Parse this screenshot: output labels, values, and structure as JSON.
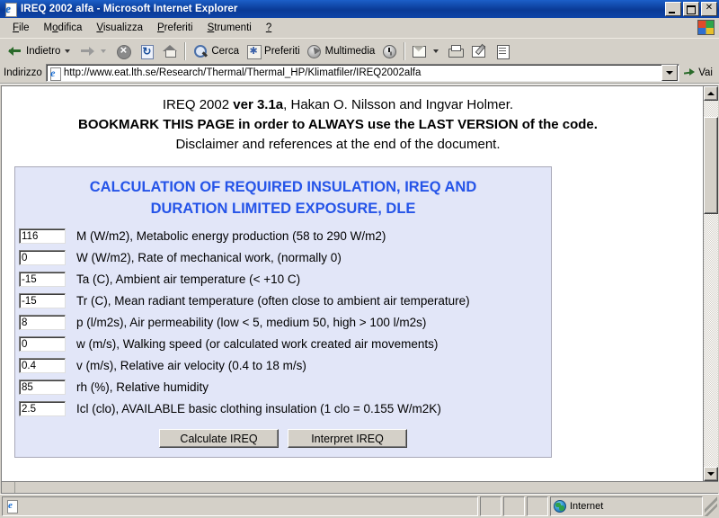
{
  "window": {
    "title": "IREQ 2002 alfa - Microsoft Internet Explorer",
    "icon": "ie-page-icon",
    "minimize_label": "_",
    "maximize_label": "❐",
    "close_label": "✕"
  },
  "menubar": {
    "items": [
      {
        "label": "File",
        "accel": "F"
      },
      {
        "label": "Modifica",
        "accel": "M"
      },
      {
        "label": "Visualizza",
        "accel": "V"
      },
      {
        "label": "Preferiti",
        "accel": "P"
      },
      {
        "label": "Strumenti",
        "accel": "S"
      },
      {
        "label": "?",
        "accel": "?"
      }
    ]
  },
  "toolbar": {
    "back_label": "Indietro",
    "forward_label": "",
    "stop_label": "",
    "refresh_label": "",
    "home_label": "",
    "search_label": "Cerca",
    "favorites_label": "Preferiti",
    "media_label": "Multimedia",
    "history_label": "",
    "mail_label": "",
    "print_label": "",
    "edit_label": "",
    "discuss_label": ""
  },
  "address_bar": {
    "label": "Indirizzo",
    "url": "http://www.eat.lth.se/Research/Thermal/Thermal_HP/Klimatfiler/IREQ2002alfa",
    "go_label": "Vai"
  },
  "document": {
    "header_line1_a": "IREQ 2002 ",
    "header_line1_b": "ver 3.1a",
    "header_line1_c": ", Hakan O. Nilsson and Ingvar Holmer.",
    "header_line2_a": "BOOKMARK THIS PAGE",
    "header_line2_b": " in order to ",
    "header_line2_c": "ALWAYS",
    "header_line2_d": " use the ",
    "header_line2_e": "LAST VERSION",
    "header_line2_f": " of the code.",
    "header_line3": "Disclaimer and references at the end of the document."
  },
  "calc_panel": {
    "title_line1": "CALCULATION OF REQUIRED INSULATION, IREQ AND",
    "title_line2": "DURATION LIMITED EXPOSURE, DLE",
    "title_color": "#2554e8",
    "background_color": "#e2e6f8",
    "fields": [
      {
        "value": "116",
        "label": "M (W/m2), Metabolic energy production (58 to 290 W/m2)"
      },
      {
        "value": "0",
        "label": "W (W/m2), Rate of mechanical work, (normally 0)"
      },
      {
        "value": "-15",
        "label": "Ta (C), Ambient air temperature (< +10 C)"
      },
      {
        "value": "-15",
        "label": "Tr (C), Mean radiant temperature (often close to ambient air temperature)"
      },
      {
        "value": "8",
        "label": "p (l/m2s), Air permeability (low < 5, medium 50, high > 100 l/m2s)"
      },
      {
        "value": "0",
        "label": "w (m/s), Walking speed (or calculated work created air movements)"
      },
      {
        "value": "0.4",
        "label": "v (m/s), Relative air velocity (0.4 to 18 m/s)"
      },
      {
        "value": "85",
        "label": "rh (%), Relative humidity"
      },
      {
        "value": "2.5",
        "label": "Icl (clo), AVAILABLE basic clothing insulation (1 clo = 0.155 W/m2K)"
      }
    ],
    "calculate_button": "Calculate IREQ",
    "interpret_button": "Interpret IREQ"
  },
  "statusbar": {
    "message": "",
    "zone_label": "Internet",
    "zone_icon": "globe-icon"
  }
}
